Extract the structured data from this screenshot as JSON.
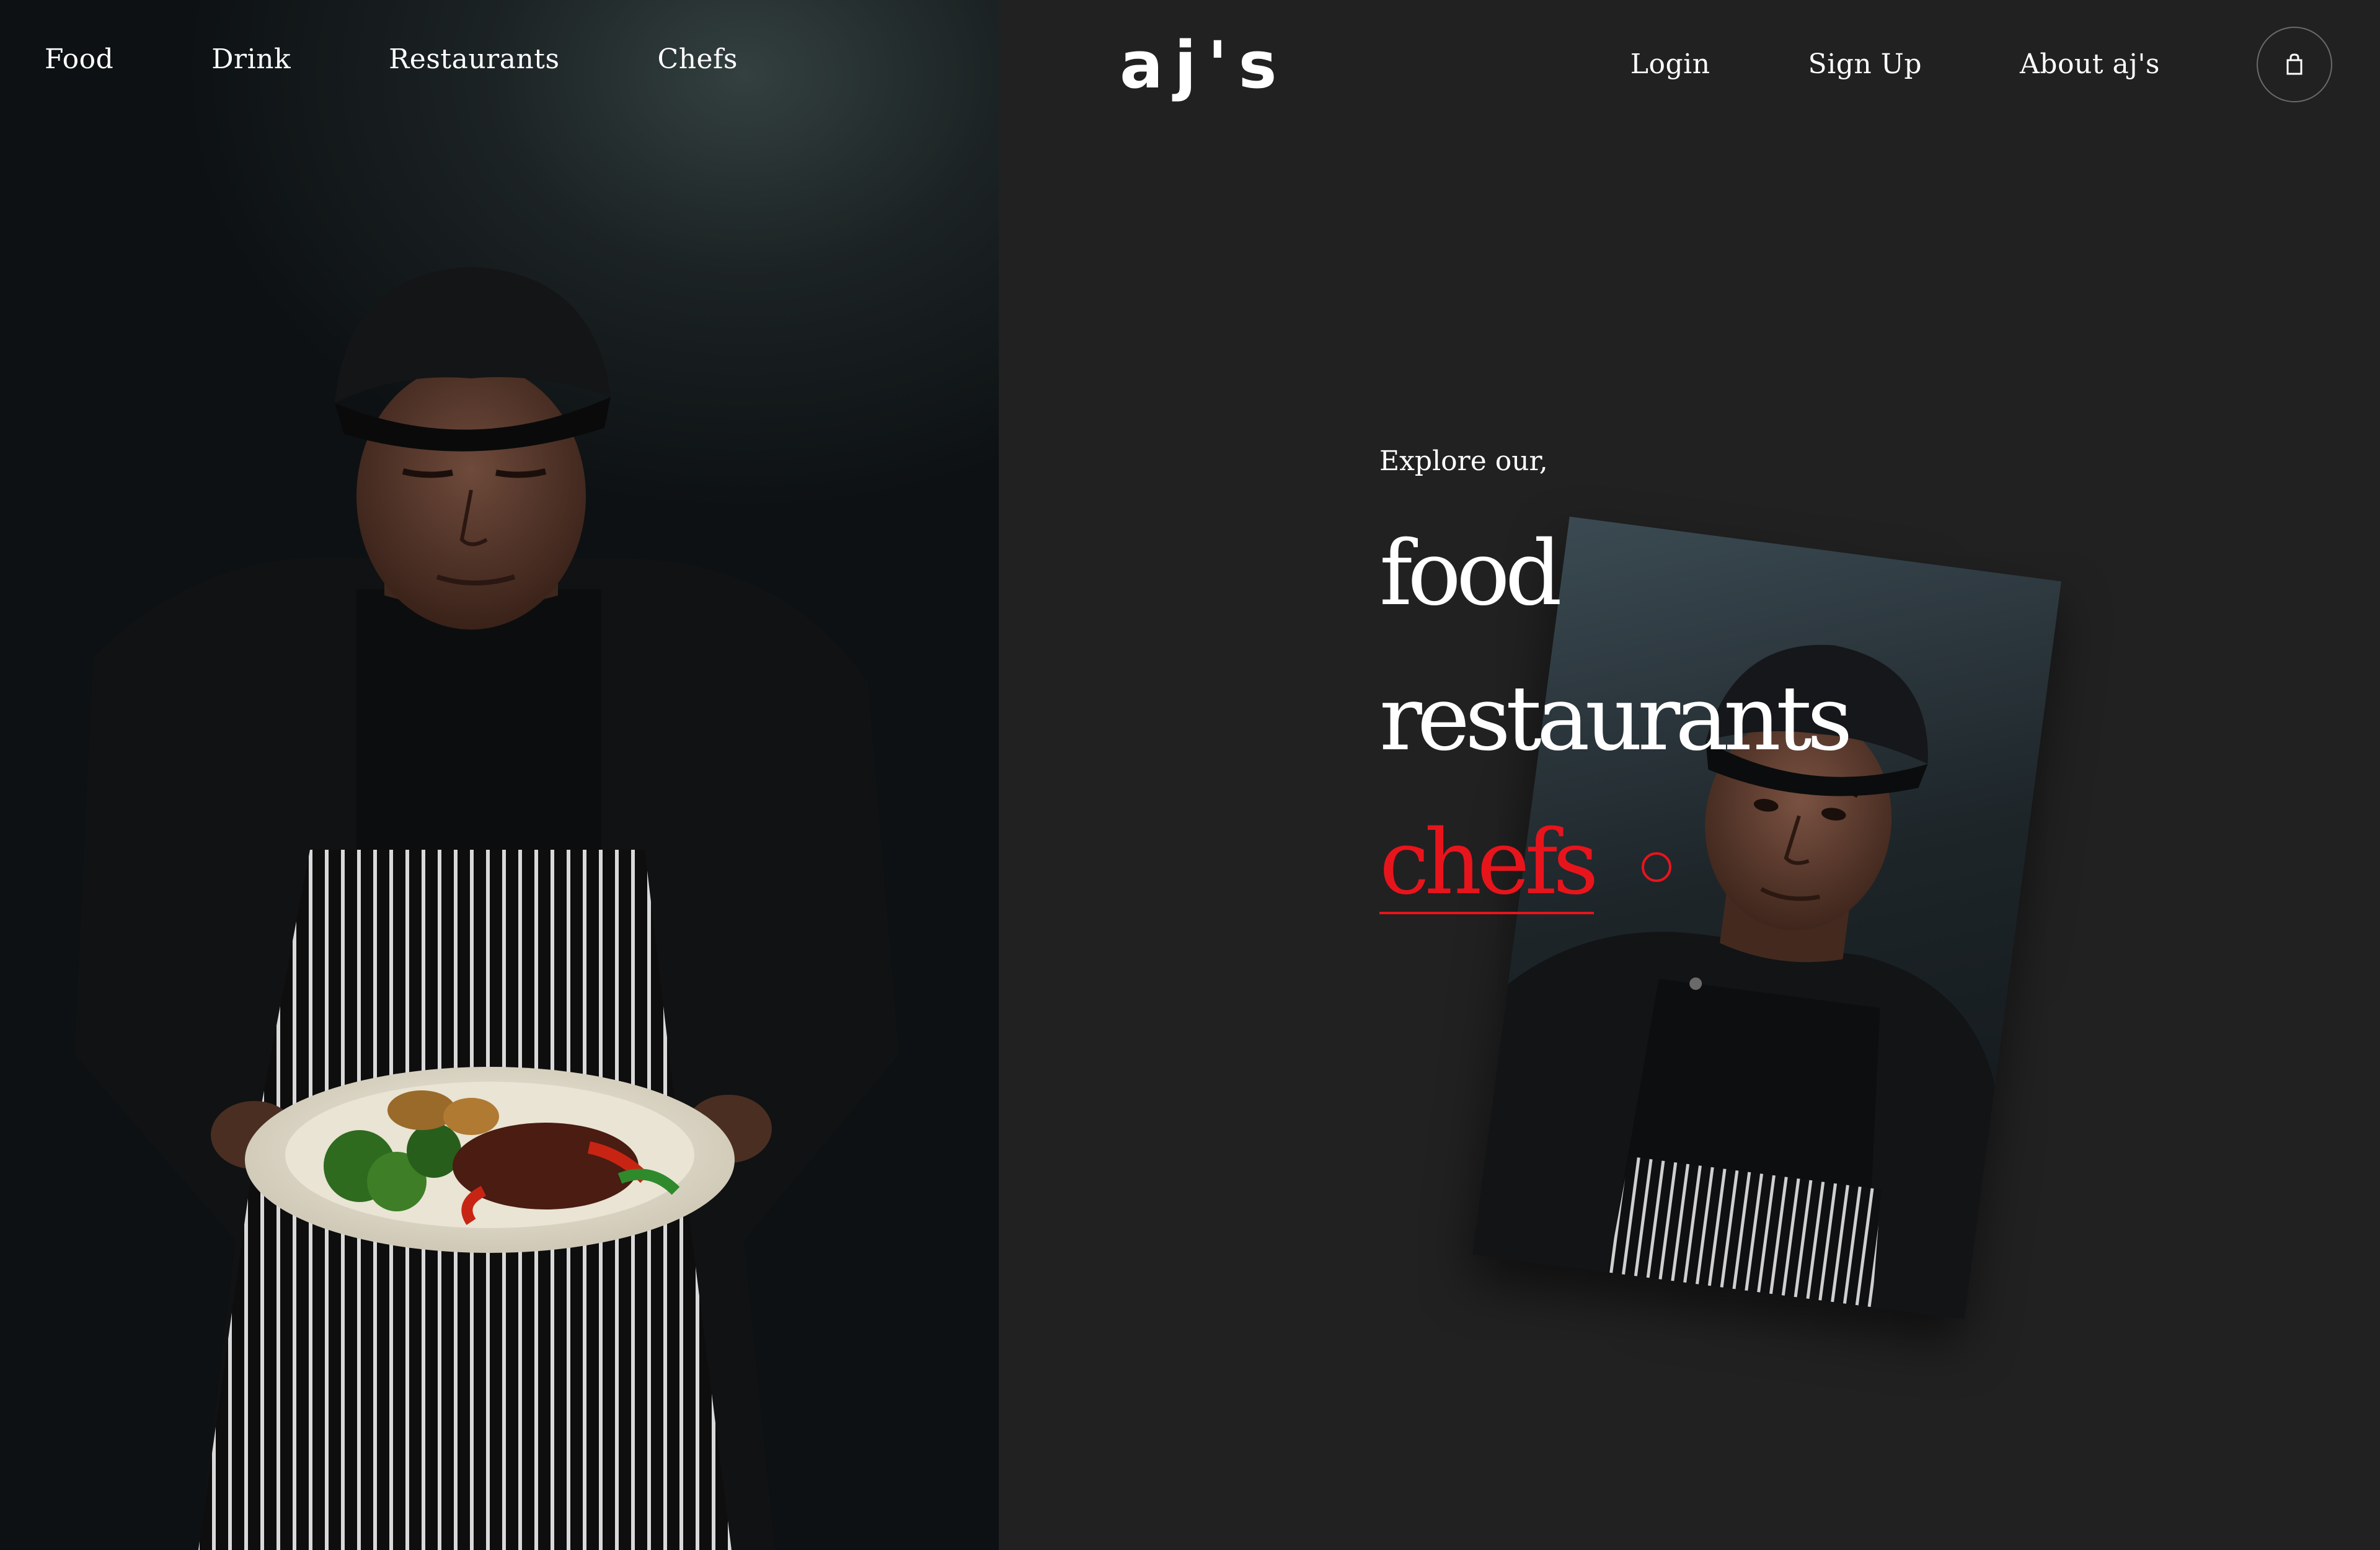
{
  "brand": {
    "logo_text": "aj's"
  },
  "nav": {
    "left_items": [
      {
        "label": "Food"
      },
      {
        "label": "Drink"
      },
      {
        "label": "Restaurants"
      },
      {
        "label": "Chefs"
      }
    ],
    "right_items": [
      {
        "label": "Login"
      },
      {
        "label": "Sign Up"
      },
      {
        "label": "About aj's"
      }
    ],
    "cart_icon": "shopping-bag-icon"
  },
  "explore": {
    "kicker": "Explore our,",
    "links": [
      {
        "label": "food",
        "active": false
      },
      {
        "label": "restaurants",
        "active": false
      },
      {
        "label": "chefs",
        "active": true
      }
    ]
  },
  "colors": {
    "background": "#212121",
    "accent": "#e8141c",
    "text": "#ffffff"
  }
}
